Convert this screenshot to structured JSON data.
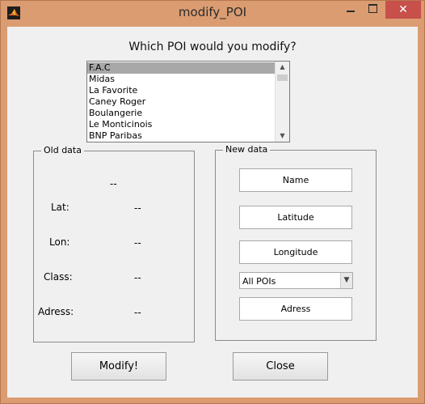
{
  "window": {
    "title": "modify_POI",
    "close_symbol": "✕"
  },
  "prompt": "Which POI would you modify?",
  "poi_list": {
    "selected_index": 0,
    "items": [
      "F.A.C",
      "Midas",
      "La Favorite",
      "Caney Roger",
      "Boulangerie",
      "Le Monticinois",
      "BNP Paribas"
    ]
  },
  "old_data": {
    "title": "Old data",
    "name_value": "--",
    "fields": [
      {
        "label": "Lat:",
        "value": "--"
      },
      {
        "label": "Lon:",
        "value": "--"
      },
      {
        "label": "Class:",
        "value": "--"
      },
      {
        "label": "Adress:",
        "value": "--"
      }
    ]
  },
  "new_data": {
    "title": "New data",
    "name_button": "Name",
    "latitude_button": "Latitude",
    "longitude_button": "Longitude",
    "class_select": {
      "value": "All POIs"
    },
    "address_button": "Adress"
  },
  "actions": {
    "modify": "Modify!",
    "close": "Close"
  },
  "icons": {
    "app": "matlab-icon",
    "minimize": "minimize-icon",
    "maximize": "maximize-icon",
    "close": "close-icon",
    "scroll_up": "chevron-up-icon",
    "scroll_down": "chevron-down-icon",
    "dropdown": "chevron-down-icon"
  }
}
